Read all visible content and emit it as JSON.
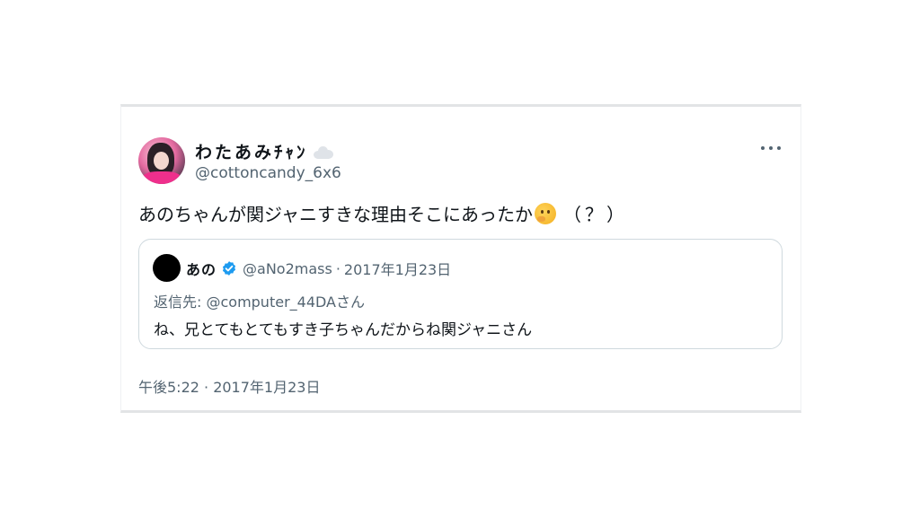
{
  "tweet": {
    "author": {
      "display_name": "わたあみﾁｬﾝ",
      "handle": "@cottoncandy_6x6",
      "avatar_icon": "profile-photo",
      "name_badge_icon": "cloud-icon"
    },
    "menu_icon": "more-horizontal-icon",
    "text": "あのちゃんが関ジャニすきな理由そこにあったか",
    "emoji": "thinking-face-emoji",
    "text_suffix": "（？）",
    "quoted": {
      "display_name": "あの",
      "verified_icon": "verified-badge-icon",
      "verified_color": "#1d9bf0",
      "handle": "@aNo2mass",
      "separator": "·",
      "date": "2017年1月23日",
      "reply_to": "返信先: @computer_44DAさん",
      "text": "ね、兄とてもとてもすき子ちゃんだからね関ジャニさん"
    },
    "timestamp": "午後5:22 · 2017年1月23日"
  },
  "colors": {
    "text_primary": "#0f1419",
    "text_secondary": "#536471",
    "border": "#cfd9de",
    "accent": "#1d9bf0"
  }
}
